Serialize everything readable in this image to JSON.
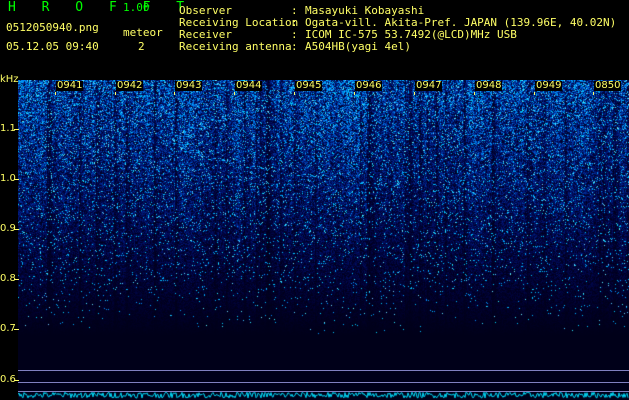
{
  "app": {
    "brand": "H R O F F T",
    "version": "1.00"
  },
  "file": {
    "name": "0512050940.png",
    "datetime": "05.12.05 09:40"
  },
  "meteor": {
    "label": "meteor",
    "count": "2"
  },
  "info": [
    {
      "key": "Observer",
      "value": "Masayuki Kobayashi"
    },
    {
      "key": "Receiving Location",
      "value": "Ogata-vill. Akita-Pref. JAPAN (139.96E, 40.02N)"
    },
    {
      "key": "Receiver",
      "value": "ICOM IC-575 53.7492(@LCD)MHz USB"
    },
    {
      "key": "Receiving antenna",
      "value": "A504HB(yagi 4el)"
    }
  ],
  "axis": {
    "unit": "kHz",
    "y_labels": [
      "1.1",
      "1.0",
      "0.9",
      "0.8",
      "0.7",
      "0.6"
    ],
    "time_labels": [
      "0941",
      "0942",
      "0943",
      "0944",
      "0945",
      "0946",
      "0947",
      "0948",
      "0949",
      "0850"
    ]
  },
  "colors": {
    "text": "#ffff66",
    "brand": "#00ff00",
    "background": "#000000"
  }
}
